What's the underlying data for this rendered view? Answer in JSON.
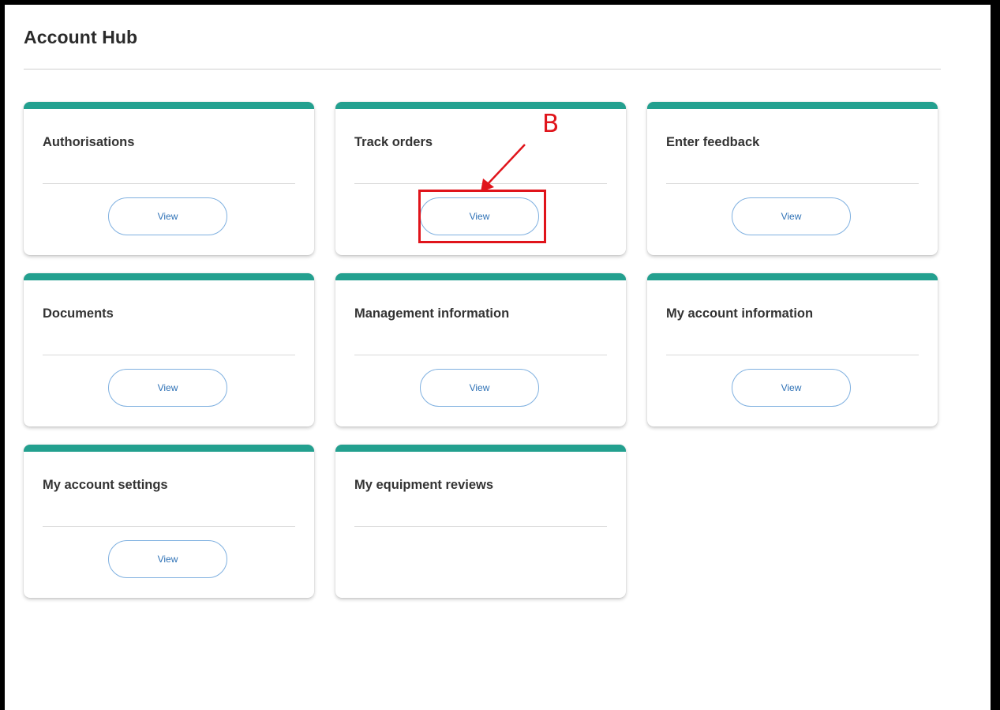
{
  "page": {
    "title": "Account Hub"
  },
  "cards": [
    {
      "title": "Authorisations",
      "button_label": "View"
    },
    {
      "title": "Track orders",
      "button_label": "View"
    },
    {
      "title": "Enter feedback",
      "button_label": "View"
    },
    {
      "title": "Documents",
      "button_label": "View"
    },
    {
      "title": "Management information",
      "button_label": "View"
    },
    {
      "title": "My account information",
      "button_label": "View"
    },
    {
      "title": "My account settings",
      "button_label": "View"
    },
    {
      "title": "My equipment reviews"
    }
  ],
  "annotation": {
    "label": "B",
    "color": "#e0141b"
  },
  "colors": {
    "card_accent": "#23a08f",
    "button_border": "#7fb0e0",
    "button_text": "#2f72b6"
  }
}
